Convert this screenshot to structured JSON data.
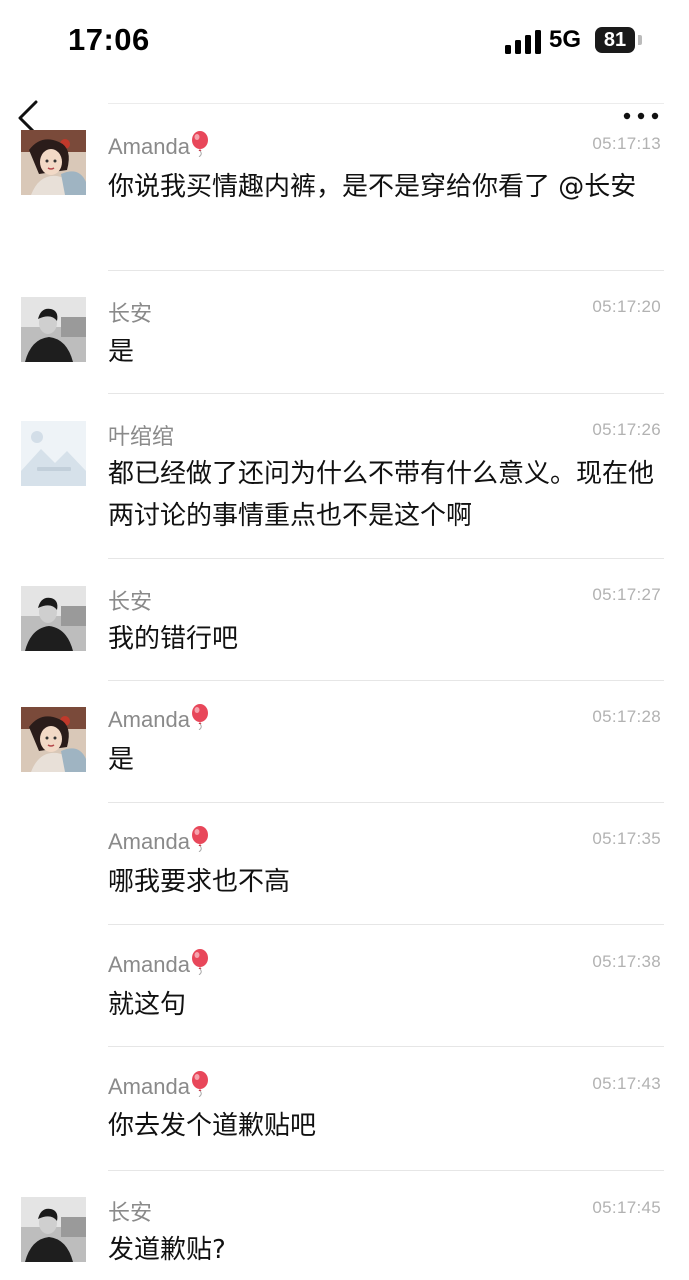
{
  "status_bar": {
    "time": "17:06",
    "network": "5G",
    "battery": "81"
  },
  "messages": [
    {
      "sender": "Amanda",
      "time": "05:17:13",
      "text": "你说我买情趣内裤，是不是穿给你看了 @长安",
      "avatar": "amanda"
    },
    {
      "sender": "长安",
      "time": "05:17:20",
      "text": "是",
      "avatar": "changan"
    },
    {
      "sender": "叶绾绾",
      "time": "05:17:26",
      "text": "都已经做了还问为什么不带有什么意义。现在他两讨论的事情重点也不是这个啊",
      "avatar": "landscape"
    },
    {
      "sender": "长安",
      "time": "05:17:27",
      "text": "我的错行吧",
      "avatar": "changan"
    },
    {
      "sender": "Amanda",
      "time": "05:17:28",
      "text": "是",
      "avatar": "amanda"
    },
    {
      "sender": "Amanda",
      "time": "05:17:35",
      "text": "哪我要求也不高",
      "avatar": "none"
    },
    {
      "sender": "Amanda",
      "time": "05:17:38",
      "text": "就这句",
      "avatar": "none"
    },
    {
      "sender": "Amanda",
      "time": "05:17:43",
      "text": "你去发个道歉贴吧",
      "avatar": "none"
    },
    {
      "sender": "长安",
      "time": "05:17:45",
      "text": "发道歉贴?",
      "avatar": "changan"
    }
  ],
  "colors": {
    "name": "#8a8a8a",
    "time": "#b2b2b2",
    "balloon": "#e8475a"
  }
}
